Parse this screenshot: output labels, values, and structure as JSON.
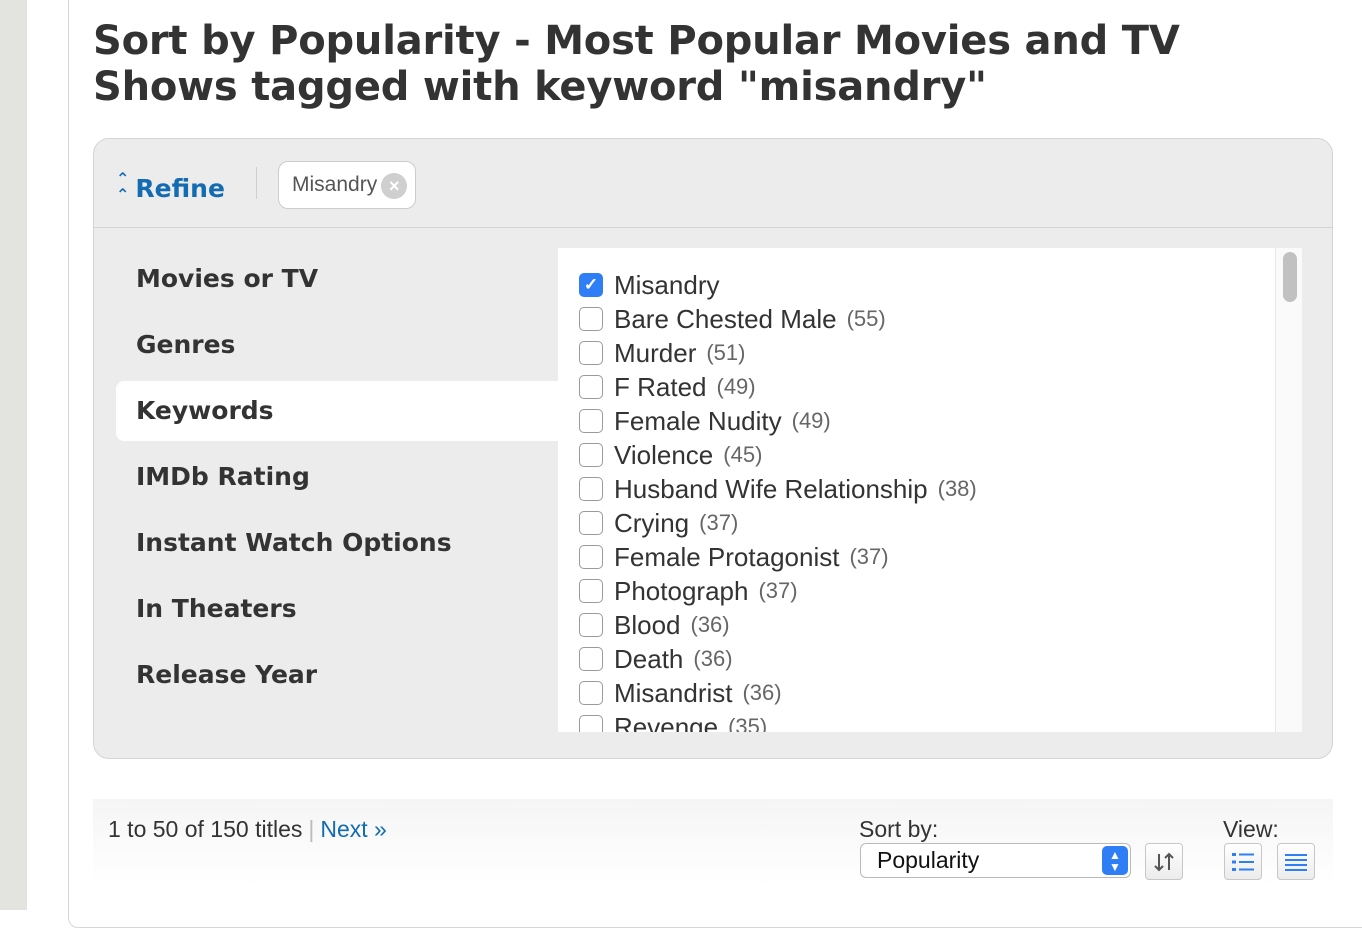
{
  "page": {
    "title": "Sort by Popularity - Most Popular Movies and TV Shows tagged with keyword \"misandry\""
  },
  "refine": {
    "label": "Refine",
    "chip_label": "Misandry",
    "chip_remove_icon": "close-circle-icon"
  },
  "categories": [
    {
      "label": "Movies or TV",
      "active": false
    },
    {
      "label": "Genres",
      "active": false
    },
    {
      "label": "Keywords",
      "active": true
    },
    {
      "label": "IMDb Rating",
      "active": false
    },
    {
      "label": "Instant Watch Options",
      "active": false
    },
    {
      "label": "In Theaters",
      "active": false
    },
    {
      "label": "Release Year",
      "active": false
    }
  ],
  "keywords": [
    {
      "label": "Misandry",
      "count": "",
      "checked": true
    },
    {
      "label": "Bare Chested Male",
      "count": "(55)",
      "checked": false
    },
    {
      "label": "Murder",
      "count": "(51)",
      "checked": false
    },
    {
      "label": "F Rated",
      "count": "(49)",
      "checked": false
    },
    {
      "label": "Female Nudity",
      "count": "(49)",
      "checked": false
    },
    {
      "label": "Violence",
      "count": "(45)",
      "checked": false
    },
    {
      "label": "Husband Wife Relationship",
      "count": "(38)",
      "checked": false
    },
    {
      "label": "Crying",
      "count": "(37)",
      "checked": false
    },
    {
      "label": "Female Protagonist",
      "count": "(37)",
      "checked": false
    },
    {
      "label": "Photograph",
      "count": "(37)",
      "checked": false
    },
    {
      "label": "Blood",
      "count": "(36)",
      "checked": false
    },
    {
      "label": "Death",
      "count": "(36)",
      "checked": false
    },
    {
      "label": "Misandrist",
      "count": "(36)",
      "checked": false
    },
    {
      "label": "Revenge",
      "count": "(35)",
      "checked": false
    }
  ],
  "results": {
    "count_text": "1 to 50 of 150 titles",
    "separator": "|",
    "next_label": "Next »",
    "sort_label": "Sort by:",
    "sort_value": "Popularity",
    "view_label": "View:"
  },
  "colors": {
    "link": "#136cb2",
    "checkbox_checked": "#2f7ef6"
  }
}
